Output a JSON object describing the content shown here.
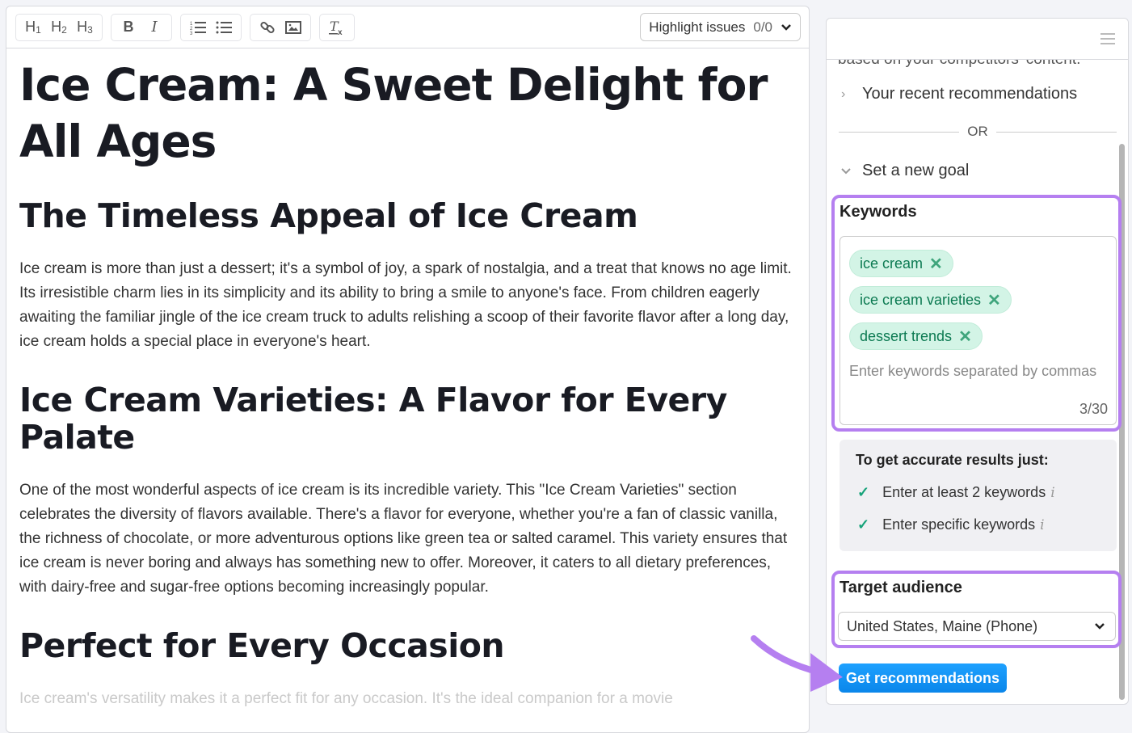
{
  "toolbar": {
    "h1": "H",
    "h1_sub": "1",
    "h2": "H",
    "h2_sub": "2",
    "h3": "H",
    "h3_sub": "3",
    "bold": "B",
    "italic": "I",
    "highlight_label": "Highlight issues",
    "highlight_count": "0/0"
  },
  "document": {
    "title": "Ice Cream: A Sweet Delight for All Ages",
    "sections": [
      {
        "heading": "The Timeless Appeal of Ice Cream",
        "body": "Ice cream is more than just a dessert; it's a symbol of joy, a spark of nostalgia, and a treat that knows no age limit. Its irresistible charm lies in its simplicity and its ability to bring a smile to anyone's face. From children eagerly awaiting the familiar jingle of the ice cream truck to adults relishing a scoop of their favorite flavor after a long day, ice cream holds a special place in everyone's heart."
      },
      {
        "heading": "Ice Cream Varieties: A Flavor for Every Palate",
        "body": "One of the most wonderful aspects of ice cream is its incredible variety. This \"Ice Cream Varieties\" section celebrates the diversity of flavors available. There's a flavor for everyone, whether you're a fan of classic vanilla, the richness of chocolate, or more adventurous options like green tea or salted caramel. This variety ensures that ice cream is never boring and always has something new to offer. Moreover, it caters to all dietary preferences, with dairy-free and sugar-free options becoming increasingly popular."
      },
      {
        "heading": "Perfect for Every Occasion",
        "body": "Ice cream's versatility makes it a perfect fit for any occasion. It's the ideal companion for a movie"
      }
    ]
  },
  "panel": {
    "cut_text": "based on your competitors' content.",
    "recent": "Your recent recommendations",
    "or": "OR",
    "new_goal": "Set a new goal",
    "keywords_label": "Keywords",
    "keywords": [
      "ice cream",
      "ice cream varieties",
      "dessert trends"
    ],
    "keywords_placeholder": "Enter keywords separated by commas",
    "keywords_count": "3/30",
    "tips_title": "To get accurate results just:",
    "tips": [
      "Enter at least 2 keywords",
      "Enter specific keywords"
    ],
    "audience_label": "Target audience",
    "audience_value": "United States, Maine (Phone)",
    "cta": "Get recommendations"
  },
  "colors": {
    "accent_purple": "#b57ff0",
    "cta_blue": "#0a86ea",
    "chip_green": "#d3f4e6",
    "check_green": "#17a37a"
  }
}
